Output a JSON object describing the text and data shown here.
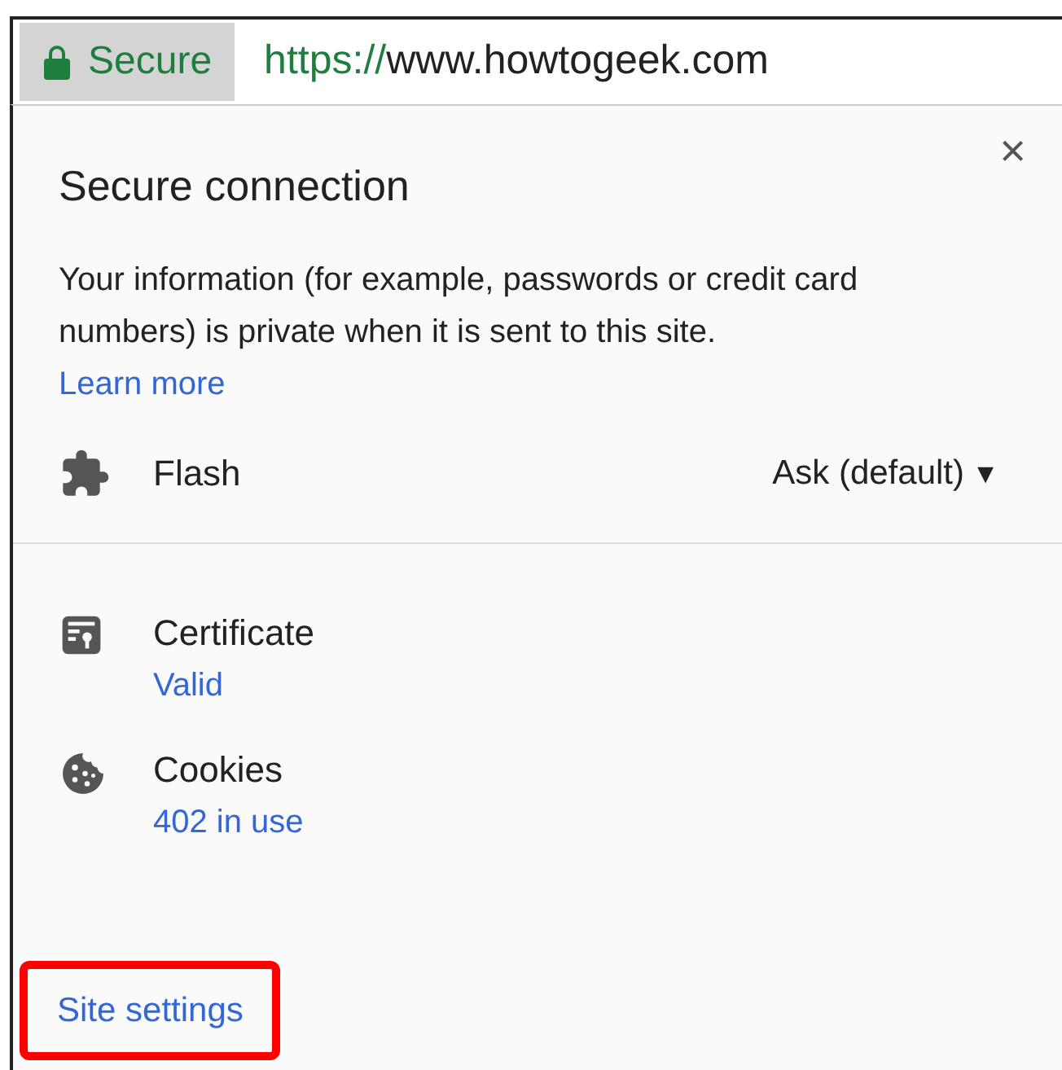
{
  "address_bar": {
    "security_chip": "Secure",
    "url_scheme": "https://",
    "url_host": "www.howtogeek.com"
  },
  "popup": {
    "title": "Secure connection",
    "close": "×",
    "description": "Your information (for example, passwords or credit card numbers) is private when it is sent to this site.",
    "learn_more": "Learn more",
    "permissions": [
      {
        "kind": "puzzle",
        "label": "Flash",
        "value": "Ask (default)",
        "caret": "▾"
      }
    ],
    "details": [
      {
        "kind": "certificate",
        "label": "Certificate",
        "status": "Valid"
      },
      {
        "kind": "cookie",
        "label": "Cookies",
        "status": "402 in use"
      }
    ],
    "site_settings": {
      "label": "Site settings",
      "highlighted": true
    }
  }
}
